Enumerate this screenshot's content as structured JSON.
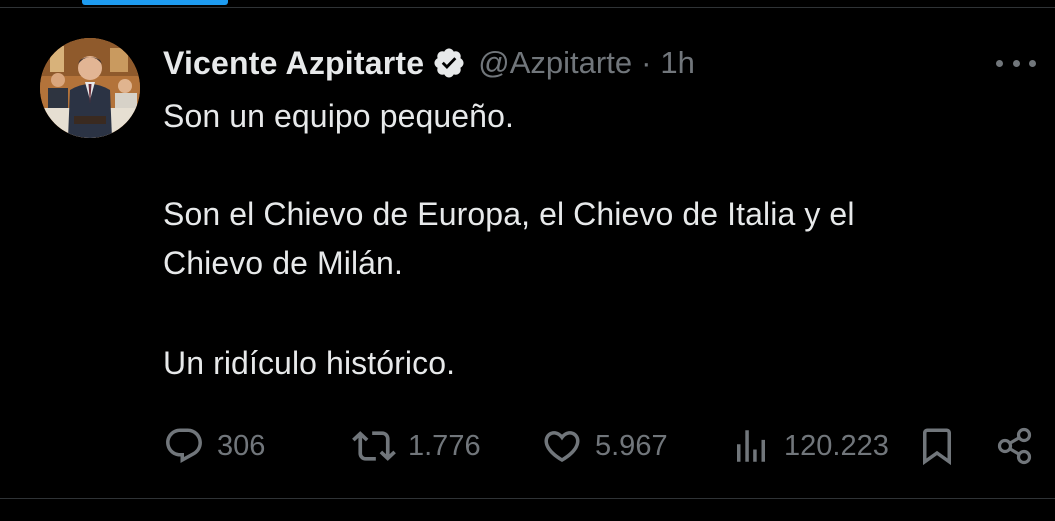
{
  "author": {
    "display_name": "Vicente Azpitarte",
    "handle": "@Azpitarte",
    "separator": "·",
    "time_ago": "1h",
    "verified": true
  },
  "tweet": {
    "lines": [
      "Son un equipo pequeño.",
      "Son el Chievo de Europa, el Chievo de Italia y el",
      "Chievo de Milán.",
      "Un ridículo histórico."
    ]
  },
  "actions": {
    "replies": "306",
    "reposts": "1.776",
    "likes": "5.967",
    "views": "120.223"
  },
  "icons": {
    "verified": "verified-badge-icon",
    "more": "more-options-icon",
    "reply": "reply-icon",
    "repost": "repost-icon",
    "like": "heart-icon",
    "views": "views-icon",
    "bookmark": "bookmark-icon",
    "share": "share-icon"
  },
  "colors": {
    "background": "#000000",
    "primary_text": "#e7e9ea",
    "secondary_text": "#71767b",
    "accent": "#1d9bf0",
    "divider": "#2f3336"
  }
}
